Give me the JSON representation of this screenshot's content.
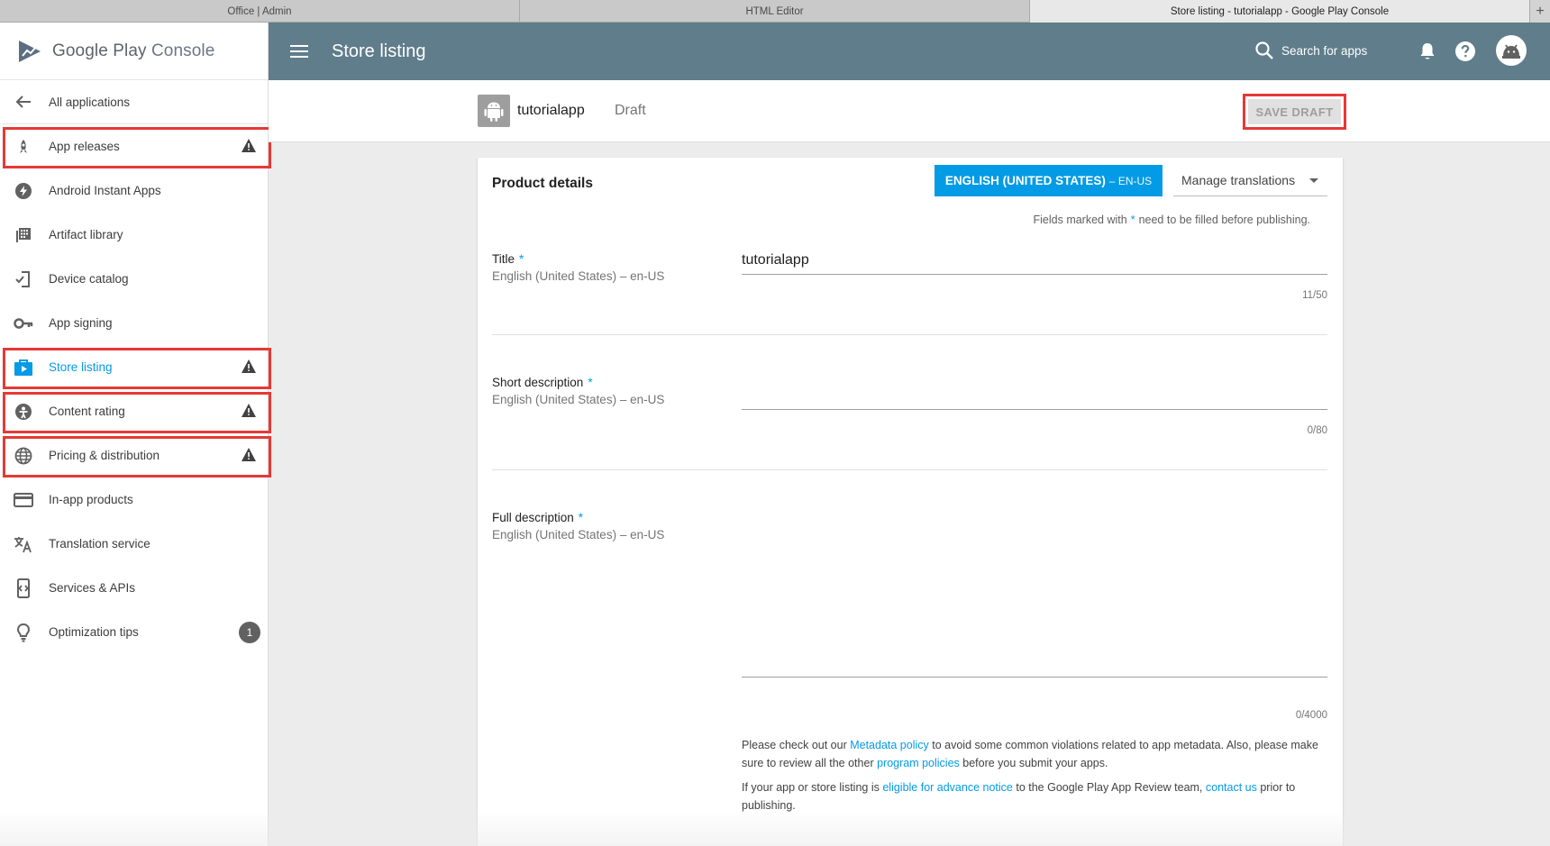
{
  "browser": {
    "tabs": [
      "Office | Admin",
      "HTML Editor",
      "Store listing - tutorialapp - Google Play Console"
    ],
    "new_tab": "+"
  },
  "brand": {
    "google_play": "Google Play",
    "console": " Console"
  },
  "sidebar": {
    "back_label": "All applications",
    "items": [
      {
        "label": "App releases",
        "icon": "rocket-icon",
        "warning": true,
        "highlighted": true
      },
      {
        "label": "Android Instant Apps",
        "icon": "bolt-icon"
      },
      {
        "label": "Artifact library",
        "icon": "library-icon"
      },
      {
        "label": "Device catalog",
        "icon": "device-check-icon"
      },
      {
        "label": "App signing",
        "icon": "key-icon"
      },
      {
        "label": "Store listing",
        "icon": "store-icon",
        "warning": true,
        "highlighted": true,
        "active": true
      },
      {
        "label": "Content rating",
        "icon": "rating-icon",
        "warning": true,
        "highlighted": true
      },
      {
        "label": "Pricing & distribution",
        "icon": "globe-icon",
        "warning": true,
        "highlighted": true
      },
      {
        "label": "In-app products",
        "icon": "card-icon"
      },
      {
        "label": "Translation service",
        "icon": "translate-icon"
      },
      {
        "label": "Services & APIs",
        "icon": "api-icon"
      },
      {
        "label": "Optimization tips",
        "icon": "lightbulb-icon",
        "badge": "1"
      }
    ]
  },
  "topbar": {
    "title": "Store listing",
    "search_label": "Search for apps"
  },
  "app": {
    "name": "tutorialapp",
    "status": "Draft",
    "save_label": "SAVE DRAFT"
  },
  "card": {
    "title": "Product details",
    "language_button": {
      "label": "ENGLISH (UNITED STATES)",
      "code": "– EN-US"
    },
    "manage_translations": "Manage translations",
    "note": {
      "before": "Fields marked with",
      "star": "*",
      "after": "need to be filled before publishing."
    },
    "fields": {
      "title": {
        "label": "Title",
        "sub": "English (United States) – en-US",
        "value": "tutorialapp",
        "counter": "11/50"
      },
      "short": {
        "label": "Short description",
        "sub": "English (United States) – en-US",
        "value": "",
        "counter": "0/80"
      },
      "full": {
        "label": "Full description",
        "sub": "English (United States) – en-US",
        "value": "",
        "counter": "0/4000"
      }
    },
    "required_mark": "*",
    "policy1": {
      "t1": "Please check out our ",
      "l1": "Metadata policy",
      "t2": " to avoid some common violations related to app metadata. Also, please make sure to review all the other ",
      "l2": "program policies",
      "t3": " before you submit your apps."
    },
    "policy2": {
      "t1": "If your app or store listing is ",
      "l1": "eligible for advance notice",
      "t2": " to the Google Play App Review team, ",
      "l2": "contact us",
      "t3": " prior to publishing."
    }
  },
  "colors": {
    "topbar": "#607d8b",
    "accent": "#039be5",
    "highlight": "#e53935"
  }
}
